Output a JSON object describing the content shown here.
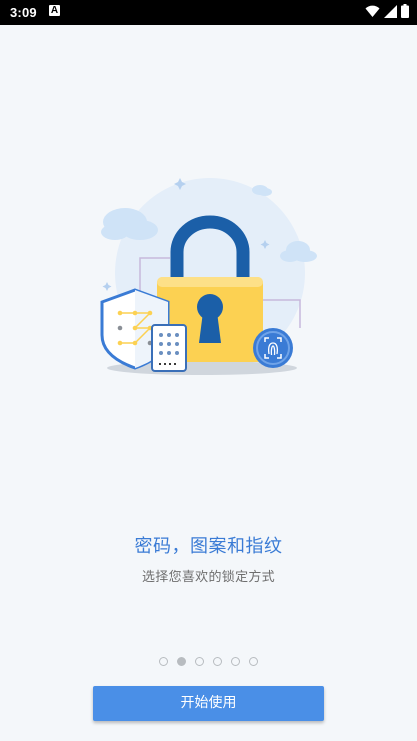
{
  "status_bar": {
    "time": "3:09",
    "notification_icon": "A"
  },
  "onboarding": {
    "title": "密码，图案和指纹",
    "subtitle": "选择您喜欢的锁定方式",
    "page_count": 6,
    "active_page": 2,
    "start_button_label": "开始使用"
  },
  "colors": {
    "accent": "#4a8fe7",
    "title_text": "#3a7bd5",
    "lock_body": "#fcd152",
    "lock_shackle": "#1b5fa8",
    "background": "#f4f7fa"
  },
  "icons": [
    "lock-illustration",
    "shield-pattern-icon",
    "keypad-icon",
    "fingerprint-icon",
    "cloud-icon",
    "wifi-icon",
    "signal-icon",
    "battery-icon"
  ]
}
